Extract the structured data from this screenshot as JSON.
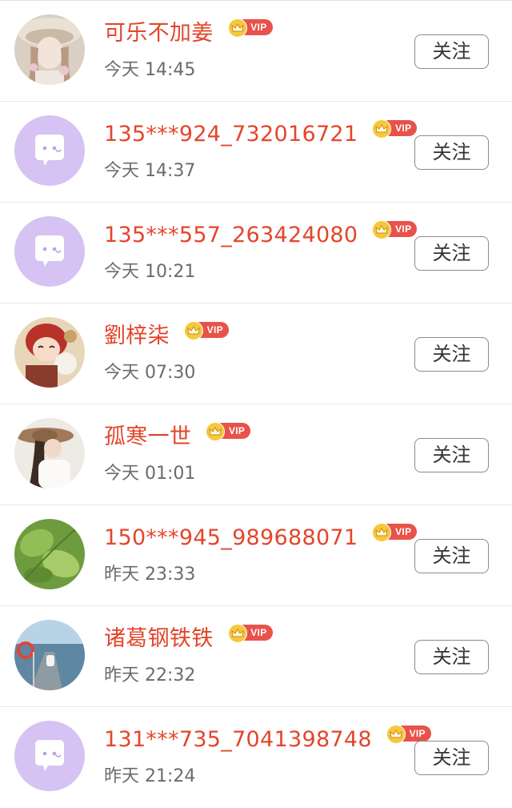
{
  "rows": [
    {
      "name": "可乐不加姜",
      "vip": "VIP",
      "time": "今天  14:45",
      "follow": "关注",
      "avatar": "illustrated-girl-avatar"
    },
    {
      "name": "135***924_732016721",
      "vip": "VIP",
      "time": "今天  14:37",
      "follow": "关注",
      "avatar": "default-chat-avatar"
    },
    {
      "name": "135***557_263424080",
      "vip": "VIP",
      "time": "今天  10:21",
      "follow": "关注",
      "avatar": "default-chat-avatar"
    },
    {
      "name": "劉梓柒",
      "vip": "VIP",
      "time": "今天  07:30",
      "follow": "关注",
      "avatar": "anime-girl-avatar"
    },
    {
      "name": "孤寒一世",
      "vip": "VIP",
      "time": "今天  01:01",
      "follow": "关注",
      "avatar": "woman-hat-avatar"
    },
    {
      "name": "150***945_989688071",
      "vip": "VIP",
      "time": "昨天  23:33",
      "follow": "关注",
      "avatar": "green-leaves-avatar"
    },
    {
      "name": "诸葛钢铁铁",
      "vip": "VIP",
      "time": "昨天  22:32",
      "follow": "关注",
      "avatar": "seaside-pier-avatar"
    },
    {
      "name": "131***735_7041398748",
      "vip": "VIP",
      "time": "昨天  21:24",
      "follow": "关注",
      "avatar": "default-chat-avatar"
    }
  ],
  "colors": {
    "name": "#e4452b",
    "vip_pill": "#e8524a",
    "crown": "#f6c83a",
    "default_avatar": "#d6c2f3"
  }
}
